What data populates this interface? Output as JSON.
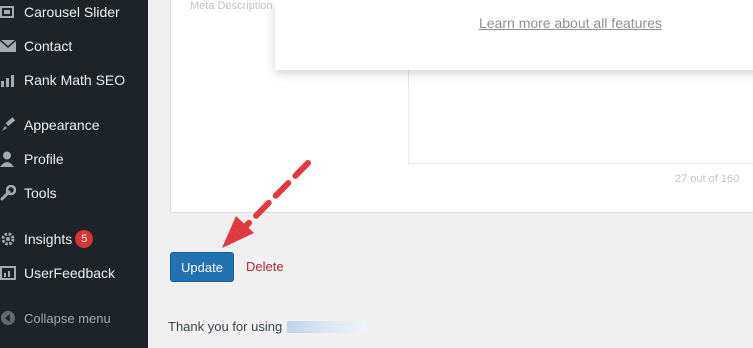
{
  "sidebar": {
    "items": [
      {
        "label": "Carousel Slider",
        "icon": "slides-icon"
      },
      {
        "label": "Contact",
        "icon": "envelope-icon"
      },
      {
        "label": "Rank Math SEO",
        "icon": "chart-icon"
      },
      {
        "label": "Appearance",
        "icon": "paintbrush-icon"
      },
      {
        "label": "Profile",
        "icon": "user-icon"
      },
      {
        "label": "Tools",
        "icon": "wrench-icon"
      },
      {
        "label": "Insights",
        "icon": "gear-icon",
        "badge": "5"
      },
      {
        "label": "UserFeedback",
        "icon": "feedback-icon"
      }
    ],
    "collapse_label": "Collapse menu"
  },
  "popup": {
    "learn_more": "Learn more about all features"
  },
  "faded": {
    "meta_label": "Meta Description",
    "count": "27 out of 160"
  },
  "actions": {
    "update_label": "Update",
    "delete_label": "Delete"
  },
  "footer": {
    "thanks": "Thank you for using"
  },
  "colors": {
    "accent": "#2271b1",
    "annotation_arrow": "#e0393e",
    "sidebar_bg": "#1d2327"
  }
}
